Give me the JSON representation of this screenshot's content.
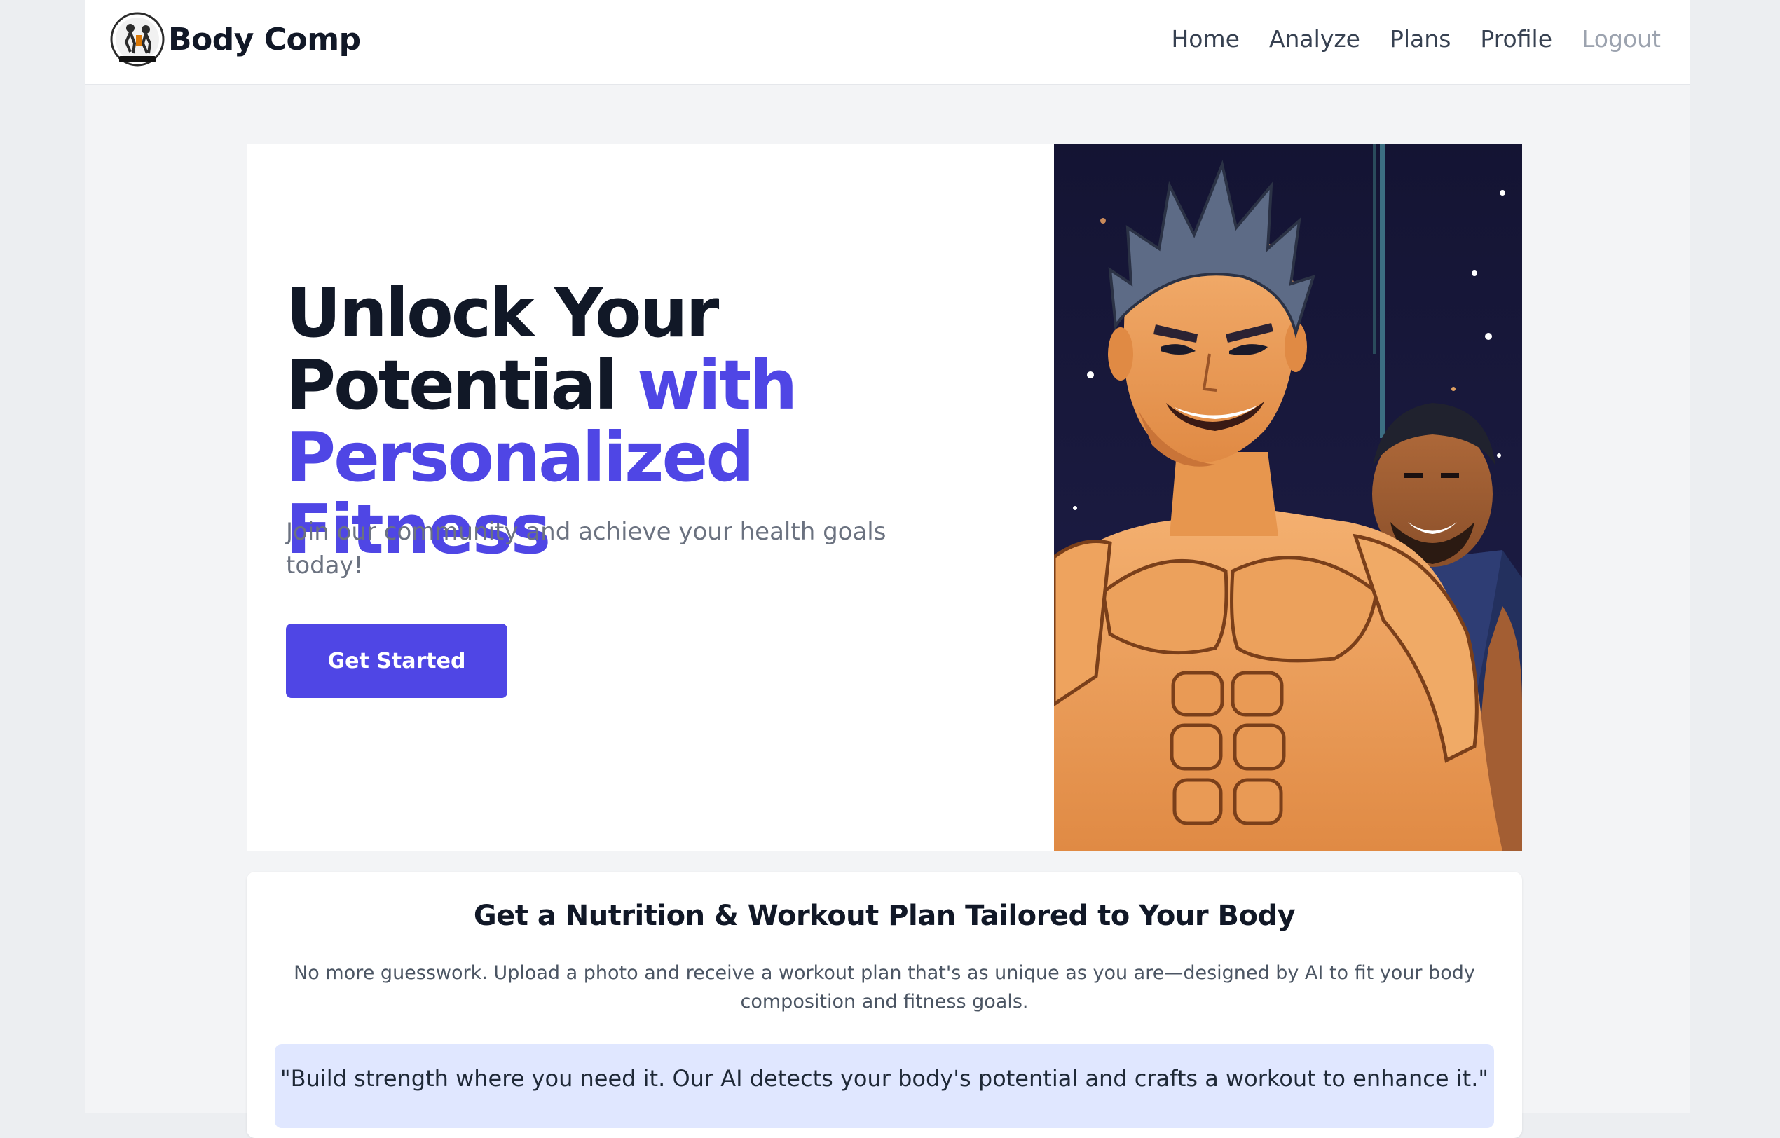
{
  "navbar": {
    "brand_name": "Body Comp",
    "links": [
      {
        "label": "Home"
      },
      {
        "label": "Analyze"
      },
      {
        "label": "Plans"
      },
      {
        "label": "Profile"
      },
      {
        "label": "Logout"
      }
    ]
  },
  "hero": {
    "title_line1": "Unlock Your",
    "title_line2_plain": "Potential ",
    "title_line2_accent": "with",
    "title_line3_accent": "Personalized Fitness",
    "subtitle": "Join our community and achieve your health goals today!",
    "cta_label": "Get Started",
    "image_icon": "anime-muscular-men-illustration"
  },
  "plan_section": {
    "title": "Get a Nutrition & Workout Plan Tailored to Your Body",
    "description": "No more guesswork. Upload a photo and receive a workout plan that's as unique as you are—designed by AI to fit your body composition and fitness goals.",
    "quote": "\"Build strength where you need it. Our AI detects your body's potential and crafts a workout to enhance it.\""
  },
  "colors": {
    "accent": "#4f46e5",
    "quote_background": "#e0e7ff",
    "hero_image_background": "#1a1a3e",
    "skin_tone": "#f0a15e"
  }
}
